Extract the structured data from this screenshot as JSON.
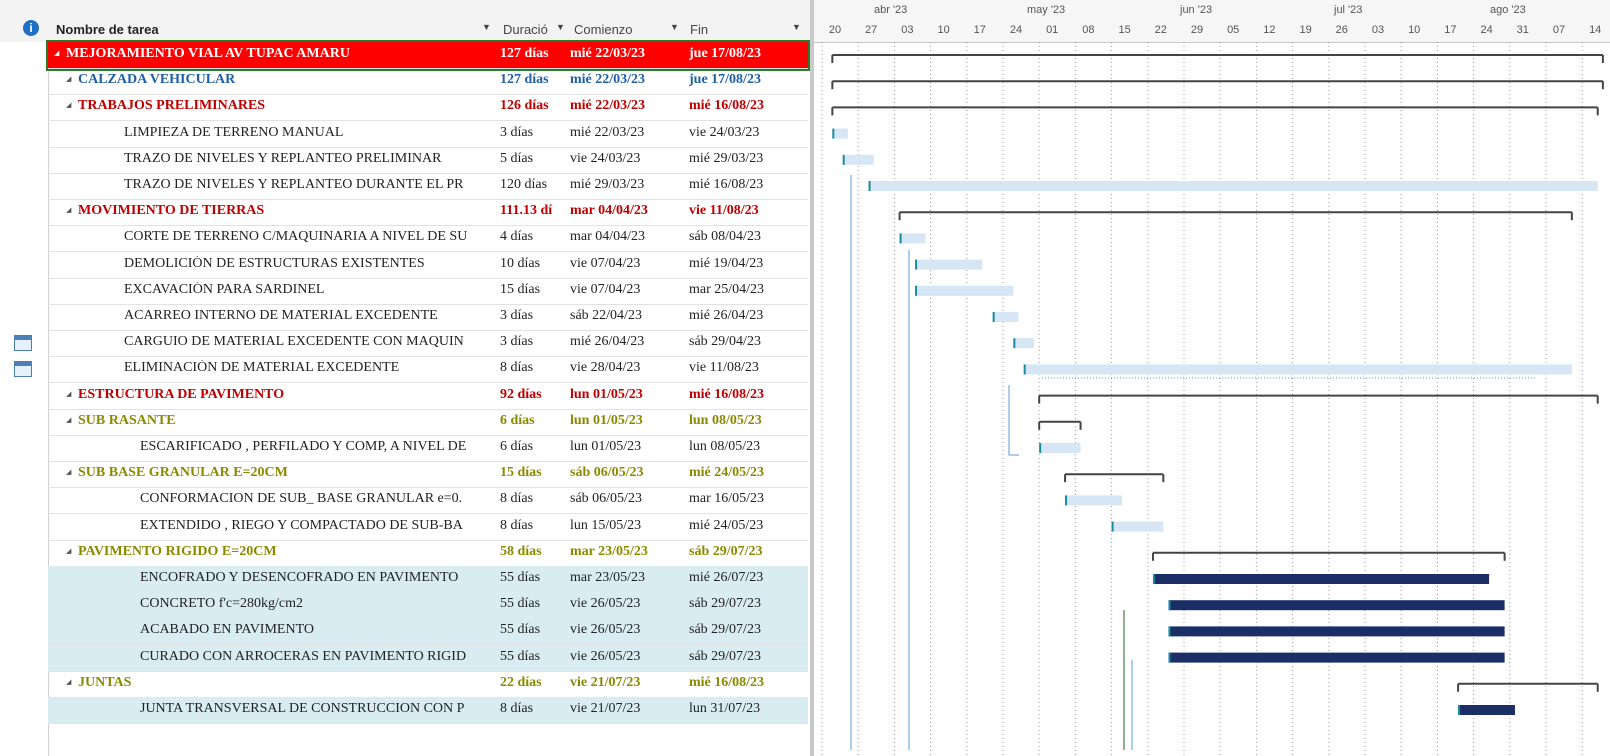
{
  "header": {
    "col_name": "Nombre de tarea",
    "col_duration": "Duració",
    "col_start": "Comienzo",
    "col_finish": "Fin"
  },
  "timeline": {
    "months": [
      {
        "label": "abr '23"
      },
      {
        "label": "may '23"
      },
      {
        "label": "jun '23"
      },
      {
        "label": "jul '23"
      },
      {
        "label": "ago '23"
      }
    ],
    "days": [
      "20",
      "27",
      "03",
      "10",
      "17",
      "24",
      "01",
      "08",
      "15",
      "22",
      "29",
      "05",
      "12",
      "19",
      "26",
      "03",
      "10",
      "17",
      "24",
      "31",
      "07",
      "14"
    ]
  },
  "tasks": [
    {
      "name": "MEJORAMIENTO VIAL AV TUPAC AMARU",
      "duration": "127 días",
      "start": "mié 22/03/23",
      "finish": "jue 17/08/23",
      "level": 0,
      "type": "root"
    },
    {
      "name": "CALZADA VEHICULAR",
      "duration": "127 días",
      "start": "mié 22/03/23",
      "finish": "jue 17/08/23",
      "level": 1,
      "type": "sum1"
    },
    {
      "name": "TRABAJOS PRELIMINARES",
      "duration": "126 días",
      "start": "mié 22/03/23",
      "finish": "mié 16/08/23",
      "level": 1,
      "type": "sum2"
    },
    {
      "name": "LIMPIEZA DE TERRENO MANUAL",
      "duration": "3 días",
      "start": "mié 22/03/23",
      "finish": "vie 24/03/23",
      "level": 2,
      "type": "task"
    },
    {
      "name": "TRAZO DE NIVELES Y REPLANTEO PRELIMINAR",
      "duration": "5 días",
      "start": "vie 24/03/23",
      "finish": "mié 29/03/23",
      "level": 2,
      "type": "task"
    },
    {
      "name": "TRAZO DE NIVELES Y REPLANTEO DURANTE EL PR",
      "duration": "120 días",
      "start": "mié 29/03/23",
      "finish": "mié 16/08/23",
      "level": 2,
      "type": "task"
    },
    {
      "name": "MOVIMIENTO DE TIERRAS",
      "duration": "111.13 dí",
      "start": "mar 04/04/23",
      "finish": "vie 11/08/23",
      "level": 1,
      "type": "sum2"
    },
    {
      "name": "CORTE DE TERRENO C/MAQUINARIA A NIVEL DE SU",
      "duration": "4 días",
      "start": "mar 04/04/23",
      "finish": "sáb 08/04/23",
      "level": 2,
      "type": "task"
    },
    {
      "name": "DEMOLICIÓN DE ESTRUCTURAS EXISTENTES",
      "duration": "10 días",
      "start": "vie 07/04/23",
      "finish": "mié 19/04/23",
      "level": 2,
      "type": "task"
    },
    {
      "name": "EXCAVACIÓN PARA SARDINEL",
      "duration": "15 días",
      "start": "vie 07/04/23",
      "finish": "mar 25/04/23",
      "level": 2,
      "type": "task"
    },
    {
      "name": "ACARREO INTERNO DE MATERIAL EXCEDENTE",
      "duration": "3 días",
      "start": "sáb 22/04/23",
      "finish": "mié 26/04/23",
      "level": 2,
      "type": "task"
    },
    {
      "name": "CARGUIO DE MATERIAL EXCEDENTE CON MAQUIN",
      "duration": "3 días",
      "start": "mié 26/04/23",
      "finish": "sáb 29/04/23",
      "level": 2,
      "type": "task",
      "icon": true
    },
    {
      "name": "ELIMINACIÓN DE MATERIAL EXCEDENTE",
      "duration": "8 días",
      "start": "vie 28/04/23",
      "finish": "vie 11/08/23",
      "level": 2,
      "type": "task",
      "icon": true
    },
    {
      "name": "ESTRUCTURA DE PAVIMENTO",
      "duration": "92 días",
      "start": "lun 01/05/23",
      "finish": "mié 16/08/23",
      "level": 1,
      "type": "sum2"
    },
    {
      "name": "SUB RASANTE",
      "duration": "6 días",
      "start": "lun 01/05/23",
      "finish": "lun 08/05/23",
      "level": 1,
      "type": "sum3"
    },
    {
      "name": "ESCARIFICADO , PERFILADO Y COMP, A NIVEL DE",
      "duration": "6 días",
      "start": "lun 01/05/23",
      "finish": "lun 08/05/23",
      "level": 3,
      "type": "task"
    },
    {
      "name": "SUB BASE GRANULAR E=20CM",
      "duration": "15 días",
      "start": "sáb 06/05/23",
      "finish": "mié 24/05/23",
      "level": 1,
      "type": "sum3"
    },
    {
      "name": "CONFORMACION DE SUB_ BASE GRANULAR e=0.",
      "duration": "8 días",
      "start": "sáb 06/05/23",
      "finish": "mar 16/05/23",
      "level": 3,
      "type": "task"
    },
    {
      "name": "EXTENDIDO , RIEGO Y COMPACTADO DE SUB-BA",
      "duration": "8 días",
      "start": "lun 15/05/23",
      "finish": "mié 24/05/23",
      "level": 3,
      "type": "task"
    },
    {
      "name": "PAVIMENTO RIGIDO E=20CM",
      "duration": "58 días",
      "start": "mar 23/05/23",
      "finish": "sáb 29/07/23",
      "level": 1,
      "type": "sum3"
    },
    {
      "name": "ENCOFRADO Y DESENCOFRADO EN PAVIMENTO",
      "duration": "55 días",
      "start": "mar 23/05/23",
      "finish": "mié 26/07/23",
      "level": 3,
      "type": "task",
      "shade": true
    },
    {
      "name": "CONCRETO f'c=280kg/cm2",
      "duration": "55 días",
      "start": "vie 26/05/23",
      "finish": "sáb 29/07/23",
      "level": 3,
      "type": "task",
      "shade": true
    },
    {
      "name": "ACABADO EN PAVIMENTO",
      "duration": "55 días",
      "start": "vie 26/05/23",
      "finish": "sáb 29/07/23",
      "level": 3,
      "type": "task",
      "shade": true
    },
    {
      "name": "CURADO CON ARROCERAS EN PAVIMENTO RIGID",
      "duration": "55 días",
      "start": "vie 26/05/23",
      "finish": "sáb 29/07/23",
      "level": 3,
      "type": "task",
      "shade": true
    },
    {
      "name": "JUNTAS",
      "duration": "22 días",
      "start": "vie 21/07/23",
      "finish": "mié 16/08/23",
      "level": 1,
      "type": "sum3"
    },
    {
      "name": "JUNTA TRANSVERSAL DE CONSTRUCCION CON P",
      "duration": "8 días",
      "start": "vie 21/07/23",
      "finish": "lun 31/07/23",
      "level": 3,
      "type": "task",
      "shade": true
    }
  ],
  "colors": {
    "root_bg": "#ff0000",
    "sum1": "#1f5fa8",
    "sum2": "#c00000",
    "sum3": "#8a8a00",
    "shade": "#d9ecf2",
    "bar_light": "#d6e6f4",
    "bar_dark": "#1b2f66",
    "summary_line": "#444444"
  }
}
